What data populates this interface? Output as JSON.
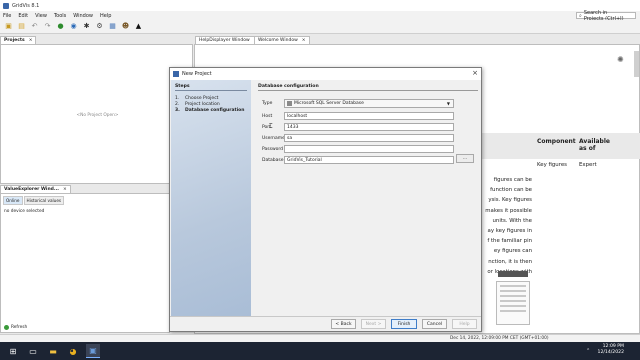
{
  "window": {
    "title": "GridVis 8.1"
  },
  "menu": {
    "items": [
      "File",
      "Edit",
      "View",
      "Tools",
      "Window",
      "Help"
    ]
  },
  "search": {
    "placeholder": "Search in Projects (Ctrl+I)"
  },
  "toolbar": {
    "icons": [
      "new-project-icon",
      "open-project-icon",
      "undo-icon",
      "redo-icon",
      "connect-icon",
      "status-icon",
      "network-icon",
      "settings-icon",
      "chart-icon",
      "users-icon",
      "graduation-cap-icon"
    ]
  },
  "projects": {
    "tab": "Projects",
    "empty_text": "<No Project Open>"
  },
  "value_explorer": {
    "tab": "ValueExplorer Wind...",
    "subtabs": [
      "Online",
      "Historical values"
    ],
    "no_device": "no device selected",
    "refresh": "Refresh"
  },
  "editor_tabs": [
    {
      "label": "HelpDisplayer Window"
    },
    {
      "label": "Welcome Window"
    }
  ],
  "doc": {
    "col_component": "Component",
    "col_available": "Available\nas of",
    "cell_component": "Key figures",
    "cell_available": "Expert",
    "text_lines": [
      "figures can be",
      "function can be",
      "ysis. Key figures",
      "makes it possible",
      "units. With the",
      "ay key figures in",
      "f the familiar pin",
      "ey figures can",
      "nction, it is then",
      "or locations with"
    ]
  },
  "dialog": {
    "title": "New Project",
    "steps_title": "Steps",
    "steps": [
      {
        "num": "1.",
        "label": "Choose Project"
      },
      {
        "num": "2.",
        "label": "Project location"
      },
      {
        "num": "3.",
        "label": "Database configuration"
      }
    ],
    "section_title": "Database configuration",
    "fields": {
      "type_label": "Type",
      "type_value": "Microsoft SQL Server Database",
      "host_label": "Host",
      "host_value": "localhost",
      "port_label": "Port",
      "port_value": "1433",
      "username_label": "Username",
      "username_value": "sa",
      "password_label": "Password",
      "password_value": "",
      "database_label": "Database",
      "database_value": "GridVis_Tutorial",
      "browse_label": "..."
    },
    "buttons": {
      "back": "< Back",
      "next": "Next >",
      "finish": "Finish",
      "cancel": "Cancel",
      "help": "Help"
    }
  },
  "statusbar": {
    "timestamp": "Dec 14, 2022, 12:09:00 PM CET (GMT+01:00)"
  },
  "taskbar": {
    "time": "12:09 PM",
    "date": "12/14/2022"
  }
}
